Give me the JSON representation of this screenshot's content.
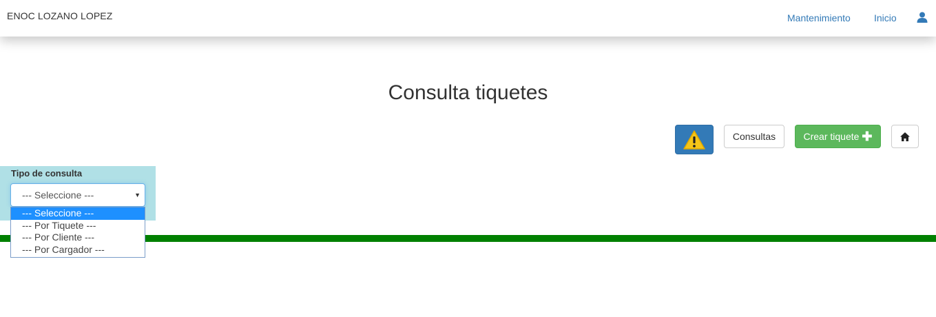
{
  "navbar": {
    "brand": "ENOC LOZANO LOPEZ",
    "links": [
      "Mantenimiento",
      "Inicio"
    ],
    "user_icon": "user-icon"
  },
  "page": {
    "title": "Consulta tiquetes"
  },
  "toolbar": {
    "alert_icon": "warning-icon",
    "consultas_label": "Consultas",
    "crear_label": "Crear tiquete",
    "home_icon": "home-icon"
  },
  "filter": {
    "label": "Tipo de consulta",
    "selected": "--- Seleccione ---",
    "options": [
      "--- Seleccione ---",
      "--- Por Tiquete ---",
      "--- Por Cliente ---",
      "--- Por Cargador ---"
    ]
  },
  "colors": {
    "link": "#337ab7",
    "primary": "#337ab7",
    "success": "#5cb85c",
    "panel": "#b0e0e6",
    "bar": "#008000",
    "highlight": "#1e90ff"
  }
}
